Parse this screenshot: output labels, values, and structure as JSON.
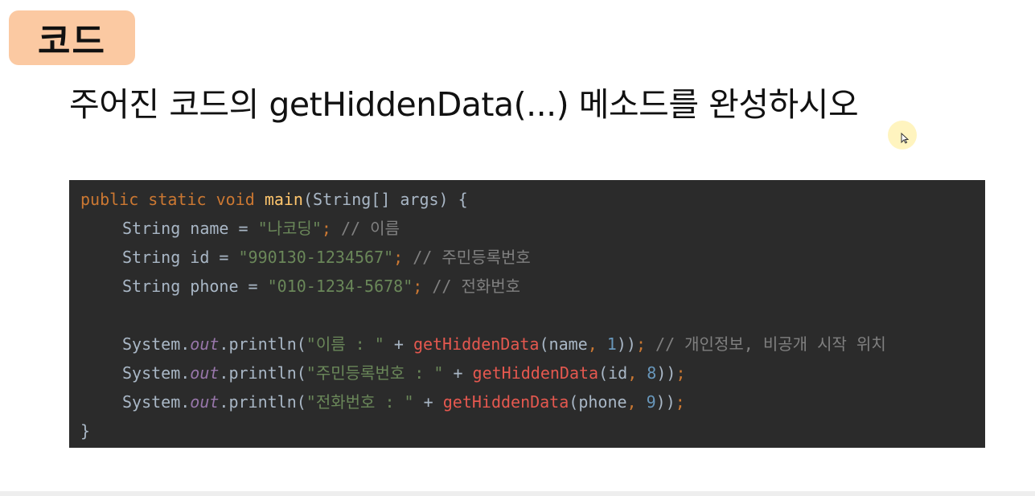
{
  "badge": {
    "label": "코드"
  },
  "heading": {
    "text": "주어진 코드의 getHiddenData(...) 메소드를 완성하시오"
  },
  "code": {
    "l1": {
      "kw_public": "public",
      "kw_static": "static",
      "kw_void": "void",
      "fn_main": "main",
      "params": "(String[] args) {"
    },
    "l2": {
      "decl": "String name = ",
      "str": "\"나코딩\"",
      "semi": ";",
      "comment": "// 이름"
    },
    "l3": {
      "decl": "String id = ",
      "str": "\"990130-1234567\"",
      "semi": ";",
      "comment": "// 주민등록번호"
    },
    "l4": {
      "decl": "String phone = ",
      "str": "\"010-1234-5678\"",
      "semi": ";",
      "comment": "// 전화번호"
    },
    "l6": {
      "sys": "System.",
      "out": "out",
      "println": ".println(",
      "str": "\"이름 : \"",
      "plus": " + ",
      "call": "getHiddenData",
      "arg": "(name",
      "comma": ",",
      "num": "1",
      "close": "))",
      "semi": ";",
      "comment": "// 개인정보, 비공개 시작 위치"
    },
    "l7": {
      "sys": "System.",
      "out": "out",
      "println": ".println(",
      "str": "\"주민등록번호 : \"",
      "plus": " + ",
      "call": "getHiddenData",
      "arg": "(id",
      "comma": ",",
      "num": "8",
      "close": "))",
      "semi": ";"
    },
    "l8": {
      "sys": "System.",
      "out": "out",
      "println": ".println(",
      "str": "\"전화번호 : \"",
      "plus": " + ",
      "call": "getHiddenData",
      "arg": "(phone",
      "comma": ",",
      "num": "9",
      "close": "))",
      "semi": ";"
    },
    "l9": {
      "brace": "}"
    }
  },
  "colors": {
    "badge_bg": "#fbc9a2",
    "code_bg": "#2b2b2b",
    "keyword": "#cc7832",
    "method_decl": "#ffc66d",
    "string": "#6a8759",
    "comment": "#808080",
    "static_field": "#9876aa",
    "method_call": "#e5584f",
    "number": "#6897bb",
    "default_text": "#a9b7c6"
  },
  "icons": {
    "cursor": "mouse-pointer-icon"
  }
}
